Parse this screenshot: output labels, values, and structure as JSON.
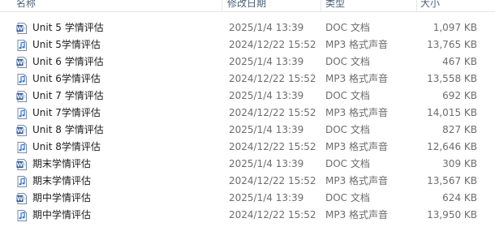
{
  "columns": {
    "name": "名称",
    "date": "修改日期",
    "type": "类型",
    "size": "大小"
  },
  "files": [
    {
      "name": "Unit 5 学情评估",
      "date": "2025/1/4 13:39",
      "type": "DOC 文档",
      "size": "1,097 KB",
      "icon": "word-doc-icon"
    },
    {
      "name": "Unit 5学情评估",
      "date": "2024/12/22 15:52",
      "type": "MP3 格式声音",
      "size": "13,765 KB",
      "icon": "audio-file-icon"
    },
    {
      "name": "Unit 6 学情评估",
      "date": "2025/1/4 13:39",
      "type": "DOC 文档",
      "size": "467 KB",
      "icon": "word-doc-icon"
    },
    {
      "name": "Unit 6学情评估",
      "date": "2024/12/22 15:52",
      "type": "MP3 格式声音",
      "size": "13,558 KB",
      "icon": "audio-file-icon"
    },
    {
      "name": "Unit 7 学情评估",
      "date": "2025/1/4 13:39",
      "type": "DOC 文档",
      "size": "692 KB",
      "icon": "word-doc-icon"
    },
    {
      "name": "Unit 7学情评估",
      "date": "2024/12/22 15:52",
      "type": "MP3 格式声音",
      "size": "14,015 KB",
      "icon": "audio-file-icon"
    },
    {
      "name": "Unit 8 学情评估",
      "date": "2025/1/4 13:39",
      "type": "DOC 文档",
      "size": "827 KB",
      "icon": "word-doc-icon"
    },
    {
      "name": "Unit 8学情评估",
      "date": "2024/12/22 15:52",
      "type": "MP3 格式声音",
      "size": "12,646 KB",
      "icon": "audio-file-icon"
    },
    {
      "name": "期末学情评估",
      "date": "2025/1/4 13:39",
      "type": "DOC 文档",
      "size": "309 KB",
      "icon": "word-doc-icon"
    },
    {
      "name": "期末学情评估",
      "date": "2024/12/22 15:52",
      "type": "MP3 格式声音",
      "size": "13,567 KB",
      "icon": "audio-file-icon"
    },
    {
      "name": "期中学情评估",
      "date": "2025/1/4 13:39",
      "type": "DOC 文档",
      "size": "624 KB",
      "icon": "word-doc-icon"
    },
    {
      "name": "期中学情评估",
      "date": "2024/12/22 15:52",
      "type": "MP3 格式声音",
      "size": "13,950 KB",
      "icon": "audio-file-icon"
    }
  ],
  "colors": {
    "doc_icon": "#2b5797",
    "audio_icon": "#3a7bd5",
    "header_text": "#4c607a",
    "detail_text": "#6d6d6d"
  }
}
